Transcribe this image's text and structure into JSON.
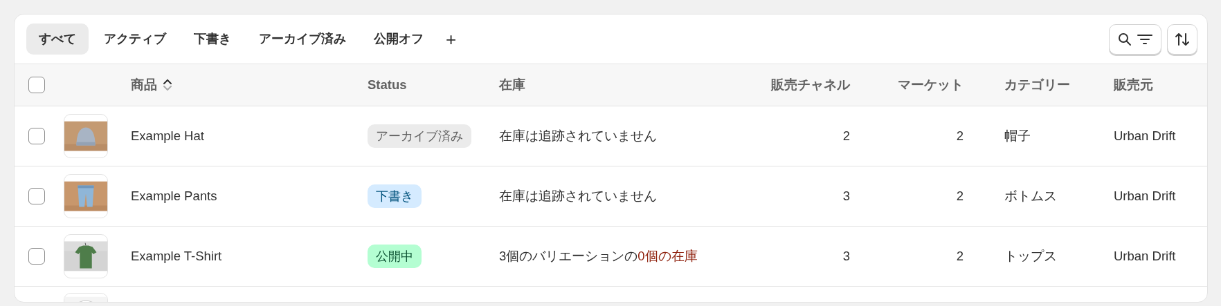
{
  "tabs": [
    {
      "label": "すべて",
      "selected": true
    },
    {
      "label": "アクティブ",
      "selected": false
    },
    {
      "label": "下書き",
      "selected": false
    },
    {
      "label": "アーカイブ済み",
      "selected": false
    },
    {
      "label": "公開オフ",
      "selected": false
    }
  ],
  "add_tab": "+",
  "table": {
    "select_all": {
      "checked": false
    },
    "columns": [
      "商品",
      "Status",
      "在庫",
      "販売チャネル",
      "マーケット",
      "カテゴリー",
      "販売元"
    ],
    "rows": [
      {
        "checked": false,
        "image": {
          "kind": "picture"
        },
        "product": "Example Hat",
        "status": {
          "label": "アーカイブ済み",
          "kind": "archived"
        },
        "inventory": "在庫は追跡されていません",
        "channels": "2",
        "markets": "2",
        "category": "帽子",
        "vendor": "Urban Drift"
      },
      {
        "checked": false,
        "image": {
          "kind": "picture"
        },
        "product": "Example Pants",
        "status": {
          "label": "下書き",
          "kind": "draft"
        },
        "inventory": "在庫は追跡されていません",
        "channels": "3",
        "markets": "2",
        "category": "ボトムス",
        "vendor": "Urban Drift"
      },
      {
        "checked": false,
        "image": {
          "kind": "picture"
        },
        "product": "Example T-Shirt",
        "status": {
          "label": "公開中",
          "kind": "active"
        },
        "inventory": "3個のバリエーションの",
        "inventory_alert": "0個の在庫",
        "channels": "3",
        "markets": "2",
        "category": "トップス",
        "vendor": "Urban Drift"
      },
      {
        "image": {
          "kind": "picture"
        }
      }
    ]
  }
}
